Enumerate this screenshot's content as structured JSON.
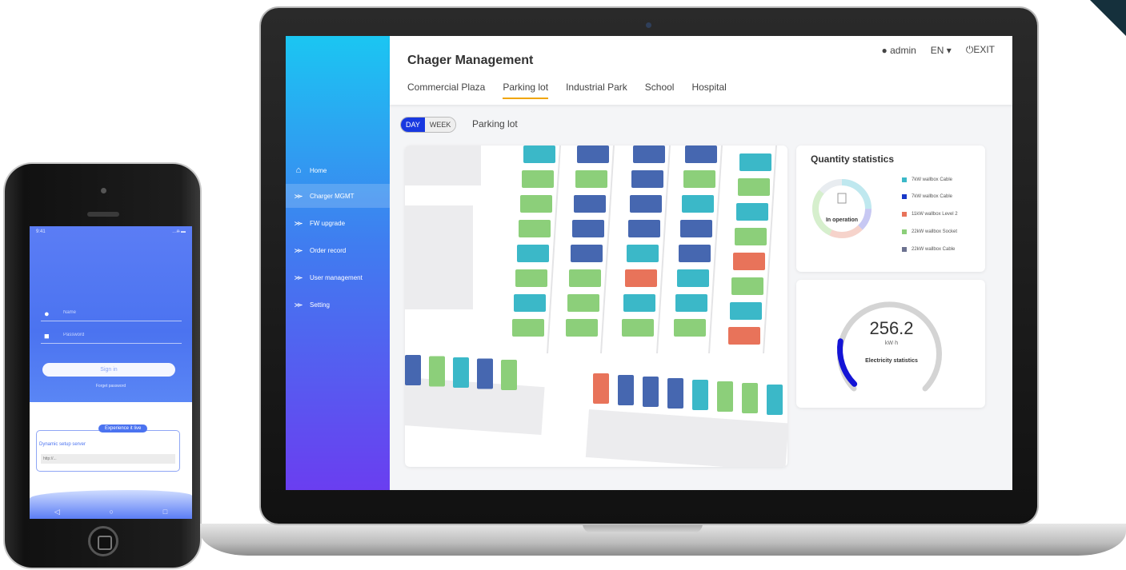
{
  "phone": {
    "status_time": "9:41",
    "status_icons": "…ᵰ ▬",
    "username_placeholder": "Name",
    "password_placeholder": "Password",
    "sign_in_label": "Sign in",
    "forget_label": "Forget password",
    "experience_badge": "Experience it live",
    "dynamic_label": "Dynamic setup server",
    "server_placeholder": "http://...",
    "nav_back": "◁",
    "nav_home": "○",
    "nav_recent": "□"
  },
  "app": {
    "title": "Chager Management",
    "user": "admin",
    "language": "EN",
    "exit_label": "EXIT",
    "tabs": [
      "Commercial Plaza",
      "Parking lot",
      "Industrial Park",
      "School",
      "Hospital"
    ],
    "active_tab": "Parking lot",
    "toggle": {
      "day": "DAY",
      "week": "WEEK",
      "active": "DAY"
    },
    "subtitle": "Parking lot"
  },
  "sidebar": {
    "items": [
      {
        "label": "Home",
        "icon": "home-icon"
      },
      {
        "label": "Charger MGMT",
        "icon": "share-icon",
        "active": true
      },
      {
        "label": "FW upgrade",
        "icon": "share-icon"
      },
      {
        "label": "Order record",
        "icon": "share-icon"
      },
      {
        "label": "User management",
        "icon": "share-icon"
      },
      {
        "label": "Setting",
        "icon": "share-icon"
      }
    ]
  },
  "quantity": {
    "title": "Quantity statistics",
    "center_label": "In operation",
    "legend": [
      {
        "label": "7kW wallbox Cable",
        "color": "#3bb8c8"
      },
      {
        "label": "7kW wallbox Cable",
        "color": "#1838c8"
      },
      {
        "label": "11kW wallbox Level 2",
        "color": "#e8735a"
      },
      {
        "label": "22kW wallbox Socket",
        "color": "#8ccf7a"
      },
      {
        "label": "22kW wallbox Cable",
        "color": "#6c7290"
      }
    ]
  },
  "electricity": {
    "value": "256.2",
    "unit": "kW·h",
    "label": "Electricity statistics",
    "fill_fraction": 0.2
  },
  "colors": {
    "teal": "#3bb8c8",
    "blue": "#4667b0",
    "green": "#8ccf7a",
    "orange": "#e8735a"
  }
}
